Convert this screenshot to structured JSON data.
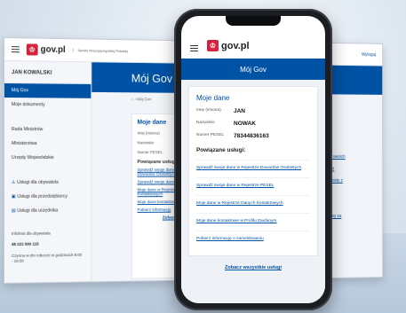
{
  "desktop": {
    "logo": "gov.pl",
    "tagline": "Serwis Rzeczypospolitej Polskiej",
    "logout": "Wyloguj",
    "user": "JAN KOWALSKI",
    "nav": [
      "Mój Gov",
      "Moje dokumenty"
    ],
    "gov_links": [
      "Rada Ministrów",
      "Ministerstwa",
      "Urzędy Wojewódzkie"
    ],
    "services": [
      "Usługi dla obywatela",
      "Usługi dla przedsiębiorcy",
      "Usługi dla urzędnika"
    ],
    "helpline_label": "Infolinia dla obywatela",
    "helpline_number": "48 222 500 115",
    "helpline_hours": "Czynna w dni robocze w godzinach 8:00 - 16:00",
    "banner_title": "Mój Gov",
    "breadcrumb": "Mój Gov",
    "card_title": "Moje dane",
    "labels": [
      "Imię (imiona)",
      "Nazwisko",
      "Numer PESEL"
    ],
    "section": "Powiązane usługi:",
    "links": [
      "Sprawdź swoje dane w Rejestrze Dowodów Osobistych",
      "Sprawdź swoje dane",
      "Moje dane w Rejestrze Danych Kontaktowych",
      "Moje dane kontaktowe",
      "Pobierz informację"
    ],
    "right_links": [
      "informacje o swoich",
      "e w dowodzie",
      "j dowód osobisty z",
      "ayanda",
      "esie dowodu",
      "ty lub czasowy za",
      "ywanych (?)",
      "e kie usługi"
    ],
    "footer_link": "Zobacz"
  },
  "phone": {
    "logo": "gov.pl",
    "banner_title": "Mój Gov",
    "card_title": "Moje dane",
    "fields": [
      {
        "label": "Imię (imiona)",
        "value": "JAN"
      },
      {
        "label": "Nazwisko",
        "value": "NOWAK"
      },
      {
        "label": "Numer PESEL",
        "value": "78344836163"
      }
    ],
    "section": "Powiązane usługi:",
    "links": [
      "Sprawdź swoje dane w Rejestrze Dowodów Osobistych",
      "Sprawdź swoje dane w Rejestrze PESEL",
      "Moje dane w Rejestrze Danych Kontaktowych",
      "Moje dane kontaktowe w Profilu Zaufanym",
      "Pobierz informację o zameldowaniu"
    ],
    "footer_link": "Zobacz wszystkie usługi"
  },
  "colors": {
    "accent": "#0052a5",
    "brand_red": "#d4213d"
  }
}
